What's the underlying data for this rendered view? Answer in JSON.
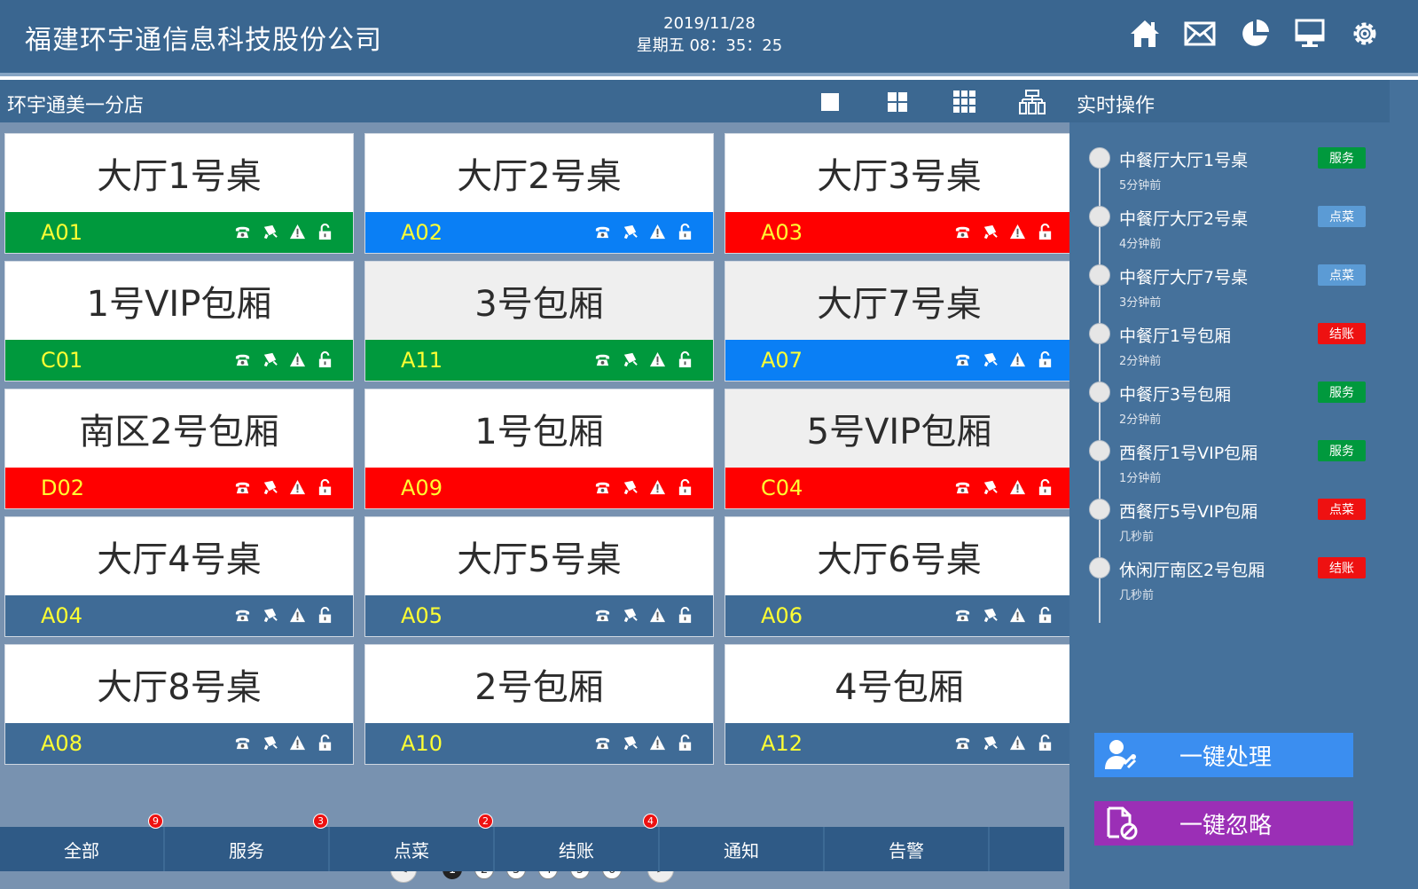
{
  "header": {
    "company": "福建环宇通信息科技股份公司",
    "date": "2019/11/28",
    "time": "星期五 08：35：25",
    "icons": [
      "home-icon",
      "mail-icon",
      "pie-chart-icon",
      "monitor-icon",
      "settings-icon"
    ]
  },
  "toolbar": {
    "store_name": "环宇通美一分店",
    "view_icons": [
      "single-view-icon",
      "grid-2x2-icon",
      "grid-3x3-icon",
      "list-view-icon"
    ]
  },
  "colors": {
    "green": "#00993d",
    "blue": "#0a7ff5",
    "red": "#ff0000",
    "neutral": "#3f6b96",
    "header_bg": "#3a6690",
    "tag_green": "#00993d",
    "tag_blue": "#5b9bd5",
    "tag_red": "#ee1111",
    "btn_blue": "#3b8ef0",
    "btn_purple": "#9b2fb6"
  },
  "tables": [
    {
      "name": "大厅1号桌",
      "code": "A01",
      "status": "green",
      "top": "white"
    },
    {
      "name": "大厅2号桌",
      "code": "A02",
      "status": "blue",
      "top": "white"
    },
    {
      "name": "大厅3号桌",
      "code": "A03",
      "status": "red",
      "top": "white"
    },
    {
      "name": "1号VIP包厢",
      "code": "C01",
      "status": "green",
      "top": "white"
    },
    {
      "name": "3号包厢",
      "code": "A11",
      "status": "green",
      "top": "gray"
    },
    {
      "name": "大厅7号桌",
      "code": "A07",
      "status": "blue",
      "top": "gray"
    },
    {
      "name": "南区2号包厢",
      "code": "D02",
      "status": "red",
      "top": "white"
    },
    {
      "name": "1号包厢",
      "code": "A09",
      "status": "red",
      "top": "white"
    },
    {
      "name": "5号VIP包厢",
      "code": "C04",
      "status": "red",
      "top": "gray"
    },
    {
      "name": "大厅4号桌",
      "code": "A04",
      "status": "neutral",
      "top": "white"
    },
    {
      "name": "大厅5号桌",
      "code": "A05",
      "status": "neutral",
      "top": "white"
    },
    {
      "name": "大厅6号桌",
      "code": "A06",
      "status": "neutral",
      "top": "white"
    },
    {
      "name": "大厅8号桌",
      "code": "A08",
      "status": "neutral",
      "top": "white"
    },
    {
      "name": "2号包厢",
      "code": "A10",
      "status": "neutral",
      "top": "white"
    },
    {
      "name": "4号包厢",
      "code": "A12",
      "status": "neutral",
      "top": "white"
    }
  ],
  "card_icons": [
    "phone-icon",
    "bell-icon",
    "warning-icon",
    "unlock-icon"
  ],
  "pager": {
    "prev": "<",
    "next": ">",
    "pages": [
      "1",
      "2",
      "3",
      "4",
      "5",
      "6"
    ],
    "current": "1"
  },
  "bottom_tabs": [
    {
      "label": "全部",
      "badge": "9"
    },
    {
      "label": "服务",
      "badge": "3"
    },
    {
      "label": "点菜",
      "badge": "2"
    },
    {
      "label": "结账",
      "badge": "4"
    },
    {
      "label": "通知",
      "badge": ""
    },
    {
      "label": "告警",
      "badge": ""
    }
  ],
  "right_panel": {
    "title": "实时操作",
    "events": [
      {
        "name": "中餐厅大厅1号桌",
        "time": "5分钟前",
        "tag": "服务",
        "tag_color": "green"
      },
      {
        "name": "中餐厅大厅2号桌",
        "time": "4分钟前",
        "tag": "点菜",
        "tag_color": "blue"
      },
      {
        "name": "中餐厅大厅7号桌",
        "time": "3分钟前",
        "tag": "点菜",
        "tag_color": "blue"
      },
      {
        "name": "中餐厅1号包厢",
        "time": "2分钟前",
        "tag": "结账",
        "tag_color": "red"
      },
      {
        "name": "中餐厅3号包厢",
        "time": "2分钟前",
        "tag": "服务",
        "tag_color": "green"
      },
      {
        "name": "西餐厅1号VIP包厢",
        "time": "1分钟前",
        "tag": "服务",
        "tag_color": "green"
      },
      {
        "name": "西餐厅5号VIP包厢",
        "time": "几秒前",
        "tag": "点菜",
        "tag_color": "red"
      },
      {
        "name": "休闲厅南区2号包厢",
        "time": "几秒前",
        "tag": "结账",
        "tag_color": "red"
      }
    ],
    "actions": {
      "handle_all": "一键处理",
      "ignore_all": "一键忽略"
    }
  }
}
